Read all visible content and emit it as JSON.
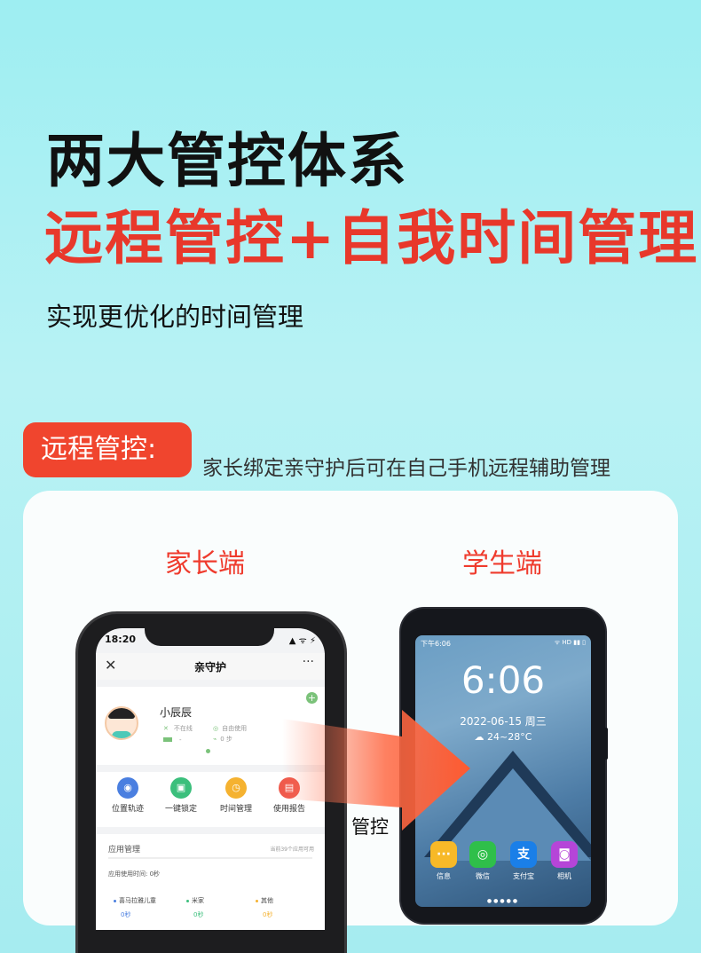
{
  "headline": {
    "line1": "两大管控体系",
    "line2": "远程管控+自我时间管理",
    "sub": "实现更优化的时间管理"
  },
  "remote": {
    "badge": "远程管控:",
    "desc": "家长绑定亲守护后可在自己手机远程辅助管理"
  },
  "labels": {
    "parent": "家长端",
    "student": "学生端",
    "control": "管控"
  },
  "parent_phone": {
    "status_time": "18:20",
    "status_icons": "▲ ᯤ ⚡",
    "close": "✕",
    "title": "亲守护",
    "more": "···",
    "child_name": "小辰辰",
    "offline": "不在线",
    "free_use": "自由使用",
    "battery": "-",
    "steps": "0 步",
    "add": "+",
    "actions": [
      {
        "label": "位置轨迹",
        "icon": "◉",
        "color": "#4a7fe0"
      },
      {
        "label": "一键锁定",
        "icon": "▣",
        "color": "#3bbf7c"
      },
      {
        "label": "时间管理",
        "icon": "◷",
        "color": "#f5b230"
      },
      {
        "label": "使用报告",
        "icon": "▤",
        "color": "#ef5a4c"
      }
    ],
    "apps_title": "应用管理",
    "apps_count": "当前39个应用可用",
    "apps_time": "应用使用时间: 0秒",
    "apps": [
      {
        "name": "喜马拉雅儿童",
        "value": "0秒",
        "color": "#4a7fe0"
      },
      {
        "name": "米家",
        "value": "0秒",
        "color": "#3bbf7c"
      },
      {
        "name": "其他",
        "value": "0秒",
        "color": "#f5b230"
      }
    ]
  },
  "student_phone": {
    "status_time": "下午6:06",
    "status_icons": "ᯤ HD ▮▮ ▯",
    "clock": "6:06",
    "date": "2022-06-15 周三",
    "weather": "☁ 24~28°C",
    "apps": [
      {
        "label": "信息",
        "icon": "···",
        "color": "#f7b928"
      },
      {
        "label": "微信",
        "icon": "◎",
        "color": "#2fbf4a"
      },
      {
        "label": "支付宝",
        "icon": "支",
        "color": "#1a7fe8"
      },
      {
        "label": "相机",
        "icon": "◙",
        "color": "#b545d8"
      }
    ],
    "dots": "●●●●●"
  }
}
